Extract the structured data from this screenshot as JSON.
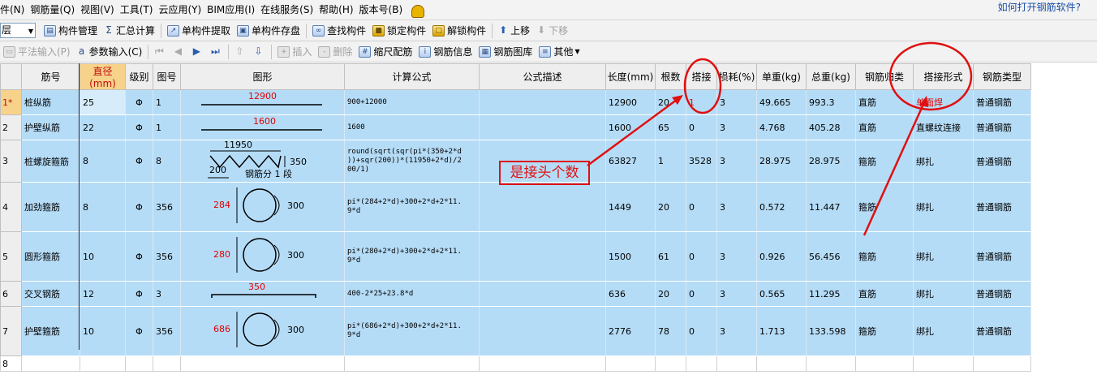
{
  "menubar": {
    "items": [
      "件(N)",
      "钢筋量(Q)",
      "视图(V)",
      "工具(T)",
      "云应用(Y)",
      "BIM应用(I)",
      "在线服务(S)",
      "帮助(H)",
      "版本号(B)"
    ],
    "help_link": "如何打开钢筋软件?"
  },
  "toolbar1": {
    "floor_value": "层",
    "buttons": [
      {
        "label": "构件管理",
        "icon": "component-manager-icon"
      },
      {
        "label": "汇总计算",
        "icon": "sigma-icon",
        "glyph": "Σ"
      },
      {
        "label": "单构件提取",
        "icon": "extract-icon"
      },
      {
        "label": "单构件存盘",
        "icon": "save-disk-icon"
      },
      {
        "label": "查找构件",
        "icon": "binoculars-icon"
      },
      {
        "label": "锁定构件",
        "icon": "lock-icon"
      },
      {
        "label": "解锁构件",
        "icon": "unlock-icon"
      },
      {
        "label": "上移",
        "icon": "arrow-up-icon"
      },
      {
        "label": "下移",
        "icon": "arrow-down-icon"
      }
    ]
  },
  "toolbar2": {
    "buttons": [
      {
        "label": "平法输入(P)",
        "icon": "plan-input-icon"
      },
      {
        "label": "参数输入(C)",
        "icon": "param-input-icon"
      },
      {
        "label": "插入",
        "icon": "insert-icon"
      },
      {
        "label": "删除",
        "icon": "delete-icon"
      },
      {
        "label": "缩尺配筋",
        "icon": "scale-icon"
      },
      {
        "label": "钢筋信息",
        "icon": "rebar-info-icon"
      },
      {
        "label": "钢筋图库",
        "icon": "rebar-library-icon"
      },
      {
        "label": "其他",
        "icon": "other-icon"
      }
    ]
  },
  "grid": {
    "headers": [
      "",
      "筋号",
      "直径(mm)",
      "级别",
      "图号",
      "图形",
      "计算公式",
      "公式描述",
      "长度(mm)",
      "根数",
      "搭接",
      "损耗(%)",
      "单重(kg)",
      "总重(kg)",
      "钢筋归类",
      "搭接形式",
      "钢筋类型"
    ],
    "rows": [
      {
        "rn": "1*",
        "name": "桩纵筋",
        "dia": "25",
        "grade": "Φ",
        "fig": "1",
        "shape_label": "12900",
        "formula": "900+12000",
        "desc": "",
        "length": "12900",
        "count": "20",
        "lap": "1",
        "loss": "3",
        "unit_w": "49.665",
        "total_w": "993.3",
        "category": "直筋",
        "lap_type": "单面焊",
        "type": "普通钢筋"
      },
      {
        "rn": "2",
        "name": "护壁纵筋",
        "dia": "22",
        "grade": "Φ",
        "fig": "1",
        "shape_label": "1600",
        "formula": "1600",
        "desc": "",
        "length": "1600",
        "count": "65",
        "lap": "0",
        "loss": "3",
        "unit_w": "4.768",
        "total_w": "405.28",
        "category": "直筋",
        "lap_type": "直螺纹连接",
        "type": "普通钢筋"
      },
      {
        "rn": "3",
        "name": "桩螺旋箍筋",
        "dia": "8",
        "grade": "Φ",
        "fig": "8",
        "shape_top": "11950",
        "shape_bottom": "200",
        "shape_right": "350",
        "shape_note": "钢筋分 1 段",
        "formula": "round(sqrt(sqr(pi*(350+2*d\n))+sqr(200))*(11950+2*d)/2\n00/1)",
        "desc": "",
        "length": "63827",
        "count": "1",
        "lap": "3528",
        "loss": "3",
        "unit_w": "28.975",
        "total_w": "28.975",
        "category": "箍筋",
        "lap_type": "绑扎",
        "type": "普通钢筋"
      },
      {
        "rn": "4",
        "name": "加劲箍筋",
        "dia": "8",
        "grade": "Φ",
        "fig": "356",
        "shape_left": "284",
        "shape_right": "300",
        "formula": "pi*(284+2*d)+300+2*d+2*11.\n9*d",
        "desc": "",
        "length": "1449",
        "count": "20",
        "lap": "0",
        "loss": "3",
        "unit_w": "0.572",
        "total_w": "11.447",
        "category": "箍筋",
        "lap_type": "绑扎",
        "type": "普通钢筋"
      },
      {
        "rn": "5",
        "name": "圆形箍筋",
        "dia": "10",
        "grade": "Φ",
        "fig": "356",
        "shape_left": "280",
        "shape_right": "300",
        "formula": "pi*(280+2*d)+300+2*d+2*11.\n9*d",
        "desc": "",
        "length": "1500",
        "count": "61",
        "lap": "0",
        "loss": "3",
        "unit_w": "0.926",
        "total_w": "56.456",
        "category": "箍筋",
        "lap_type": "绑扎",
        "type": "普通钢筋"
      },
      {
        "rn": "6",
        "name": "交叉钢筋",
        "dia": "12",
        "grade": "Φ",
        "fig": "3",
        "shape_label": "350",
        "formula": "400-2*25+23.8*d",
        "desc": "",
        "length": "636",
        "count": "20",
        "lap": "0",
        "loss": "3",
        "unit_w": "0.565",
        "total_w": "11.295",
        "category": "直筋",
        "lap_type": "绑扎",
        "type": "普通钢筋"
      },
      {
        "rn": "7",
        "name": "护壁箍筋",
        "dia": "10",
        "grade": "Φ",
        "fig": "356",
        "shape_left": "686",
        "shape_right": "300",
        "formula": "pi*(686+2*d)+300+2*d+2*11.\n9*d",
        "desc": "",
        "length": "2776",
        "count": "78",
        "lap": "0",
        "loss": "3",
        "unit_w": "1.713",
        "total_w": "133.598",
        "category": "箍筋",
        "lap_type": "绑扎",
        "type": "普通钢筋"
      }
    ],
    "empty_row_number": "8"
  },
  "annotation": {
    "note": "是接头个数",
    "color": "#e01010"
  }
}
